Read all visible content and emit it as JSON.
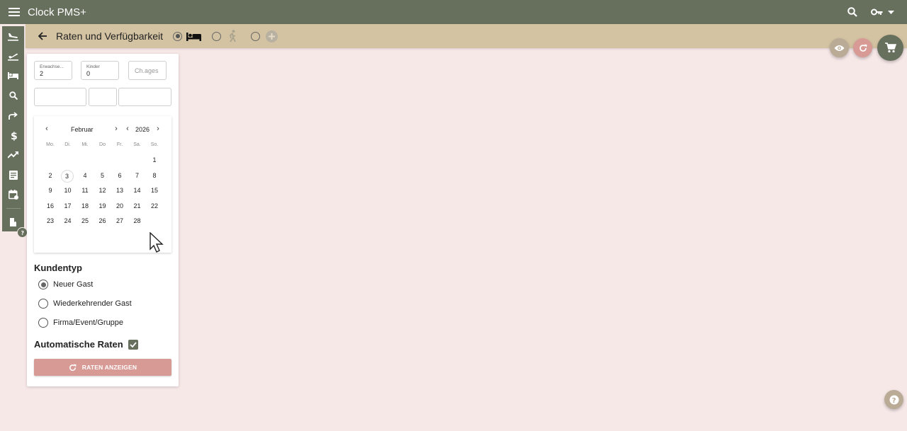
{
  "app": {
    "title": "Clock PMS+"
  },
  "header": {
    "title": "Raten und Verfügbarkeit"
  },
  "occupancy": {
    "adults_label": "Erwachse...",
    "adults_value": "2",
    "children_label": "Kinder",
    "children_value": "0",
    "child_ages_placeholder": "Ch.ages"
  },
  "calendar": {
    "month": "Februar",
    "year": "2026",
    "weekdays": [
      "Mo.",
      "Di.",
      "Mi.",
      "Do",
      "Fr.",
      "Sa.",
      "So."
    ],
    "days": [
      "1",
      "2",
      "3",
      "4",
      "5",
      "6",
      "7",
      "8",
      "9",
      "10",
      "11",
      "12",
      "13",
      "14",
      "15",
      "16",
      "17",
      "18",
      "19",
      "20",
      "21",
      "22",
      "23",
      "24",
      "25",
      "26",
      "27",
      "28"
    ],
    "highlighted_day": "3"
  },
  "customer_type": {
    "title": "Kundentyp",
    "options": [
      "Neuer Gast",
      "Wiederkehrender Gast",
      "Firma/Event/Gruppe"
    ],
    "selected": "Neuer Gast"
  },
  "auto_rates": {
    "label": "Automatische Raten",
    "checked": true
  },
  "actions": {
    "show_rates_label": "RATEN ANZEIGEN"
  },
  "colors": {
    "topbar": "#676f5d",
    "subbar": "#d3c3a2",
    "background": "#f7e8e8",
    "accent_button": "#d89a95"
  },
  "icons": {
    "top": [
      "menu-icon",
      "search-icon",
      "key-icon",
      "chevron-down-icon"
    ],
    "sidebar": [
      "arrival-icon",
      "departure-icon",
      "bed-icon",
      "search-icon",
      "forward-icon",
      "dollar-icon",
      "trending-icon",
      "report-icon",
      "calendar-icon",
      "book-icon"
    ],
    "fabs": [
      "eye-icon",
      "refresh-icon",
      "cart-icon",
      "help-icon"
    ]
  }
}
